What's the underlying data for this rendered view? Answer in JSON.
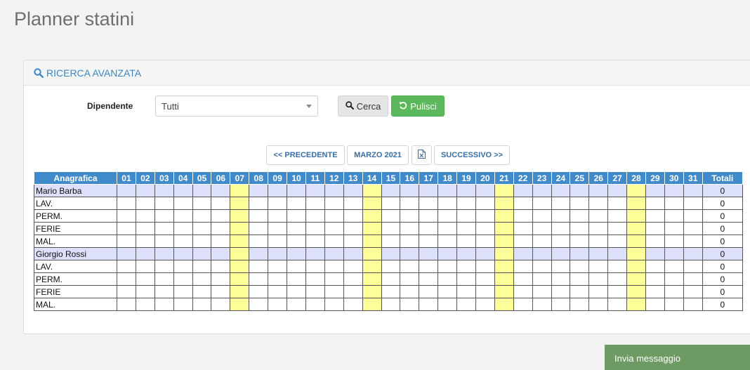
{
  "page": {
    "title": "Planner statini"
  },
  "search_panel": {
    "title": "RICERCA AVANZATA",
    "dipendente_label": "Dipendente",
    "dipendente_value": "Tutti",
    "search_label": "Cerca",
    "clear_label": "Pulisci"
  },
  "nav": {
    "prev_label": "<< PRECEDENTE",
    "month_label": "MARZO 2021",
    "next_label": "SUCCESSIVO >>"
  },
  "planner": {
    "name_header": "Anagrafica",
    "total_header": "Totali",
    "days": [
      "01",
      "02",
      "03",
      "04",
      "05",
      "06",
      "07",
      "08",
      "09",
      "10",
      "11",
      "12",
      "13",
      "14",
      "15",
      "16",
      "17",
      "18",
      "19",
      "20",
      "21",
      "22",
      "23",
      "24",
      "25",
      "26",
      "27",
      "28",
      "29",
      "30",
      "31"
    ],
    "highlighted_days": [
      "07",
      "14",
      "21",
      "28"
    ],
    "rows": [
      {
        "label": "Mario Barba",
        "type": "employee",
        "total": "0"
      },
      {
        "label": "LAV.",
        "type": "category",
        "total": "0"
      },
      {
        "label": "PERM.",
        "type": "category",
        "total": "0"
      },
      {
        "label": "FERIE",
        "type": "category",
        "total": "0"
      },
      {
        "label": "MAL.",
        "type": "category",
        "total": "0"
      },
      {
        "label": "Giorgio Rossi",
        "type": "employee",
        "total": "0"
      },
      {
        "label": "LAV.",
        "type": "category",
        "total": "0"
      },
      {
        "label": "PERM.",
        "type": "category",
        "total": "0"
      },
      {
        "label": "FERIE",
        "type": "category",
        "total": "0"
      },
      {
        "label": "MAL.",
        "type": "category",
        "total": "0"
      }
    ]
  },
  "message_bar": {
    "label": "Invia messaggio"
  },
  "colors": {
    "header_blue": "#428bca",
    "sunday_highlight": "#ffff99",
    "employee_row": "#dde0fa",
    "clear_button": "#5cb85c",
    "message_bar": "#6e9a64"
  },
  "icons": {
    "search": "search-icon",
    "refresh": "refresh-icon",
    "excel": "excel-icon",
    "caret": "chevron-down-icon"
  }
}
